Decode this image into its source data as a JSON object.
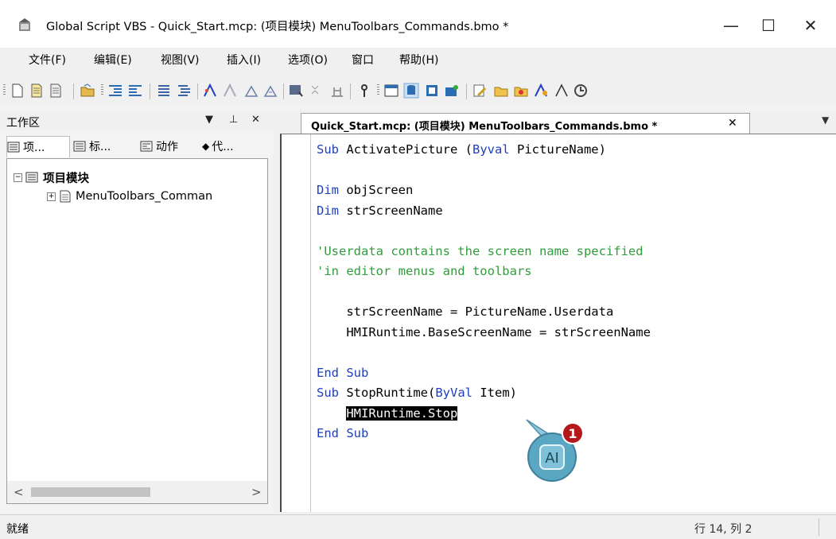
{
  "window": {
    "title": "Global Script VBS - Quick_Start.mcp: (项目模块) MenuToolbars_Commands.bmo *",
    "minimize_glyph": "—",
    "maximize_glyph": "☐",
    "close_glyph": "✕",
    "icon": "global-script-app-icon"
  },
  "menu": {
    "items": [
      {
        "label": "文件(F)"
      },
      {
        "label": "编辑(E)"
      },
      {
        "label": "视图(V)"
      },
      {
        "label": "插入(I)"
      },
      {
        "label": "选项(O)"
      },
      {
        "label": "窗口"
      },
      {
        "label": "帮助(H)"
      }
    ]
  },
  "toolbar": {
    "icons": [
      "new-document-icon",
      "copy-document-icon",
      "paste-document-icon",
      "open-folder-icon",
      "indent-icon",
      "outdent-icon",
      "comment-icon",
      "uncomment-icon",
      "function-icon",
      "action-icon",
      "tag-icon",
      "tag-select-icon",
      "screen-icon",
      "compare-icon",
      "check-icon",
      "key-icon",
      "window-icon",
      "database-icon",
      "project-icon",
      "tool-icon",
      "edit-icon",
      "folder-icon",
      "info-icon",
      "trigger-icon",
      "measure-icon",
      "clock-icon"
    ]
  },
  "workspace": {
    "title": "工作区",
    "pin_glyph": "▼ ⊥ ✕",
    "tabs": [
      {
        "label": "项..."
      },
      {
        "label": "标..."
      },
      {
        "label": "动作"
      },
      {
        "label": "代..."
      }
    ],
    "tree": {
      "root": {
        "label": "项目模块",
        "expander": "−"
      },
      "child": {
        "label": "MenuToolbars_Comman",
        "expander": "+"
      }
    },
    "scroll_left": "<",
    "scroll_right": ">"
  },
  "editor": {
    "tab_label": "Quick_Start.mcp: (项目模块) MenuToolbars_Commands.bmo *",
    "tab_close": "✕",
    "tab_menu": "▼",
    "lines": [
      {
        "kw1": "Sub",
        "t1": " ActivatePicture (",
        "kw2": "Byval",
        "t2": " PictureName)"
      },
      {
        "kw1": "",
        "t1": "",
        "kw2": "",
        "t2": ""
      },
      {
        "kw1": "Dim",
        "t1": " objScreen",
        "kw2": "",
        "t2": ""
      },
      {
        "kw1": "Dim",
        "t1": " strScreenName",
        "kw2": "",
        "t2": ""
      },
      {
        "kw1": "",
        "t1": "",
        "kw2": "",
        "t2": ""
      },
      {
        "comment": "'Userdata contains the screen name specified"
      },
      {
        "comment": "'in editor menus and toolbars"
      },
      {
        "kw1": "",
        "t1": "",
        "kw2": "",
        "t2": ""
      },
      {
        "kw1": "",
        "t1": "    strScreenName = PictureName.Userdata",
        "kw2": "",
        "t2": ""
      },
      {
        "kw1": "",
        "t1": "    HMIRuntime.BaseScreenName = strScreenName",
        "kw2": "",
        "t2": ""
      },
      {
        "kw1": "",
        "t1": "",
        "kw2": "",
        "t2": ""
      },
      {
        "kw1": "End",
        "t1": " ",
        "kw2": "Sub",
        "t2": ""
      },
      {
        "kw1": "Sub",
        "t1": " StopRuntime(",
        "kw2": "ByVal",
        "t2": " Item)"
      },
      {
        "selected": "HMIRuntime.Stop"
      },
      {
        "kw1": "End",
        "t1": " ",
        "kw2": "Sub",
        "t2": ""
      }
    ]
  },
  "callout": {
    "number": "1",
    "cursor_glyph": "AI",
    "accent": "#b5171a",
    "bubble": "#5aa7c4"
  },
  "status": {
    "text": "就绪",
    "position": "行 14, 列 2"
  }
}
